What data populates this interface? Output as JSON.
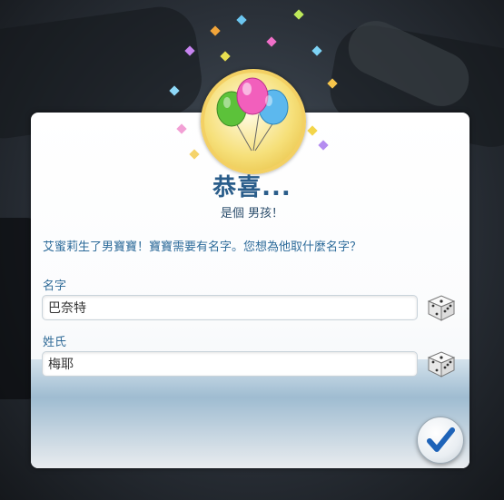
{
  "dialog": {
    "title": "恭喜...",
    "subtitle": "是個 男孩！",
    "message": "艾蜜莉生了男寶寶！寶寶需要有名字。您想為他取什麼名字？",
    "first_name": {
      "label": "名字",
      "value": "巴奈特"
    },
    "last_name": {
      "label": "姓氏",
      "value": "梅耶"
    },
    "confirm_icon": "checkmark-icon",
    "randomize_icon": "dice-icon",
    "header_icon": "balloons-icon"
  },
  "colors": {
    "title": "#2a5d8a",
    "message": "#2d6b9a",
    "confirm_check": "#1e63b8"
  }
}
